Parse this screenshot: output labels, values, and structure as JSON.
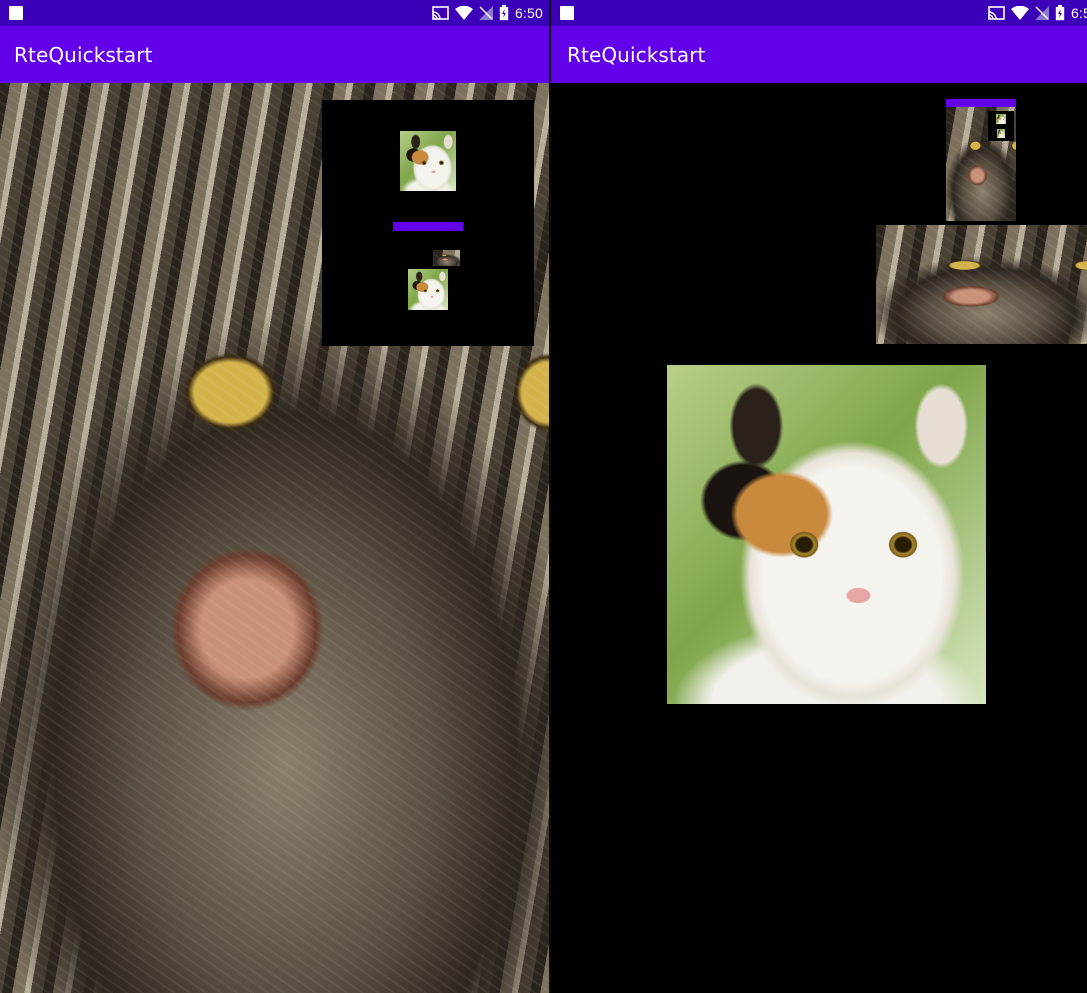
{
  "left": {
    "status_time": "6:50",
    "app_title": "RteQuickstart"
  },
  "right": {
    "status_time": "6:5",
    "app_title": "RteQuickstart"
  },
  "icons": [
    "status-square-icon",
    "cast-icon",
    "wifi-icon",
    "signal-icon",
    "battery-icon"
  ],
  "colors": {
    "status_bar": "#3b00b8",
    "app_bar": "#6200ea",
    "background": "#000000"
  }
}
